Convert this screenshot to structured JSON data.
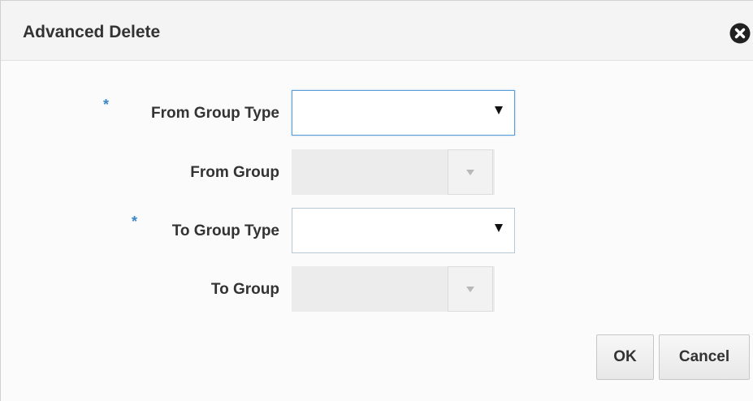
{
  "dialog": {
    "title": "Advanced Delete",
    "close_icon": "close-circle-icon"
  },
  "form": {
    "required_marker": "*",
    "from_group_type": {
      "label": "From Group Type",
      "required": true,
      "value": ""
    },
    "from_group": {
      "label": "From Group",
      "required": false,
      "disabled": true,
      "value": ""
    },
    "to_group_type": {
      "label": "To Group Type",
      "required": true,
      "value": ""
    },
    "to_group": {
      "label": "To Group",
      "required": false,
      "disabled": true,
      "value": ""
    }
  },
  "buttons": {
    "ok": "OK",
    "cancel": "Cancel"
  },
  "colors": {
    "required_marker": "#3a86c8",
    "focus_border": "#5a9cd6"
  }
}
